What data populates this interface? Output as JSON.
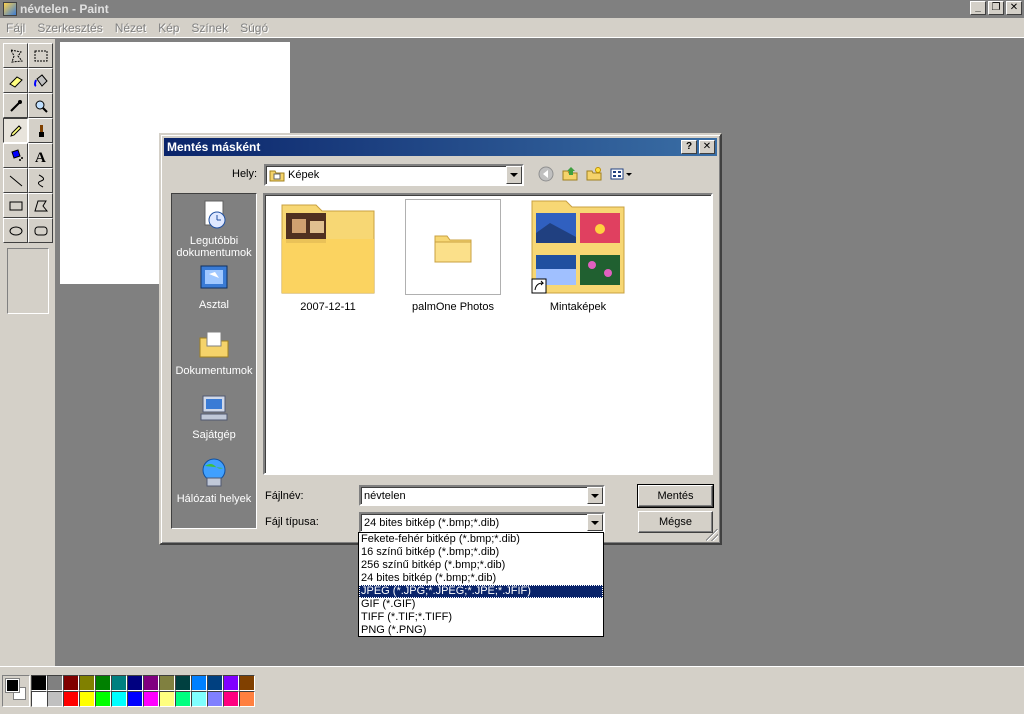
{
  "window": {
    "title": "névtelen - Paint",
    "minimize": "_",
    "restore": "❐",
    "close": "✕"
  },
  "menu": [
    "Fájl",
    "Szerkesztés",
    "Nézet",
    "Kép",
    "Színek",
    "Súgó"
  ],
  "tools": [
    {
      "name": "free-select",
      "icon": "free-select-icon"
    },
    {
      "name": "rect-select",
      "icon": "rect-select-icon"
    },
    {
      "name": "eraser",
      "icon": "eraser-icon"
    },
    {
      "name": "fill",
      "icon": "fill-bucket-icon"
    },
    {
      "name": "color-picker",
      "icon": "eyedropper-icon"
    },
    {
      "name": "magnifier",
      "icon": "magnifier-icon"
    },
    {
      "name": "pencil",
      "icon": "pencil-icon",
      "active": true
    },
    {
      "name": "brush",
      "icon": "brush-icon"
    },
    {
      "name": "airbrush",
      "icon": "airbrush-icon"
    },
    {
      "name": "text",
      "icon": "text-icon"
    },
    {
      "name": "line",
      "icon": "line-icon"
    },
    {
      "name": "curve",
      "icon": "curve-icon"
    },
    {
      "name": "rectangle",
      "icon": "rectangle-icon"
    },
    {
      "name": "polygon",
      "icon": "polygon-icon"
    },
    {
      "name": "ellipse",
      "icon": "ellipse-icon"
    },
    {
      "name": "rounded-rect",
      "icon": "rounded-rect-icon"
    }
  ],
  "palette": {
    "foreground": "#000000",
    "background": "#ffffff",
    "colors": [
      "#000000",
      "#808080",
      "#800000",
      "#808000",
      "#008000",
      "#008080",
      "#000080",
      "#800080",
      "#808040",
      "#004040",
      "#0080ff",
      "#004080",
      "#8000ff",
      "#804000",
      "#ffffff",
      "#c0c0c0",
      "#ff0000",
      "#ffff00",
      "#00ff00",
      "#00ffff",
      "#0000ff",
      "#ff00ff",
      "#ffff80",
      "#00ff80",
      "#80ffff",
      "#8080ff",
      "#ff0080",
      "#ff8040"
    ]
  },
  "dialog": {
    "title": "Mentés másként",
    "help_btn": "?",
    "close_btn": "✕",
    "location_label": "Hely:",
    "location_value": "Képek",
    "places": [
      {
        "label": "Legutóbbi dokumentumok",
        "icon": "recent-documents-icon"
      },
      {
        "label": "Asztal",
        "icon": "desktop-icon"
      },
      {
        "label": "Dokumentumok",
        "icon": "documents-folder-icon"
      },
      {
        "label": "Sajátgép",
        "icon": "my-computer-icon"
      },
      {
        "label": "Hálózati helyek",
        "icon": "network-places-icon"
      }
    ],
    "files": [
      {
        "label": "2007-12-11",
        "icon": "folder-photo-icon"
      },
      {
        "label": "palmOne Photos",
        "icon": "folder-icon"
      },
      {
        "label": "Mintaképek",
        "icon": "folder-samples-shortcut-icon"
      }
    ],
    "filename_label": "Fájlnév:",
    "filename_value": "névtelen",
    "filetype_label": "Fájl típusa:",
    "filetype_value": "24 bites bitkép (*.bmp;*.dib)",
    "save_button": "Mentés",
    "cancel_button": "Mégse",
    "filetype_options": [
      "Fekete-fehér bitkép (*.bmp;*.dib)",
      "16 színű bitkép (*.bmp;*.dib)",
      "256 színű bitkép (*.bmp;*.dib)",
      "24 bites bitkép (*.bmp;*.dib)",
      "JPEG (*.JPG;*.JPEG;*.JPE;*.JFIF)",
      "GIF (*.GIF)",
      "TIFF (*.TIF;*.TIFF)",
      "PNG (*.PNG)"
    ],
    "selected_option_index": 4
  }
}
